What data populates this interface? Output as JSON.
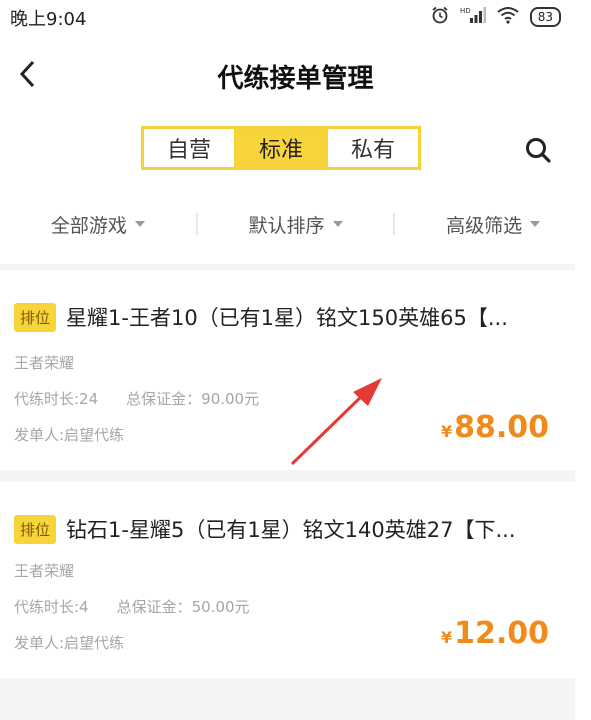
{
  "status_bar": {
    "time": "晚上9:04",
    "network": "HD",
    "battery": "83"
  },
  "header": {
    "title": "代练接单管理"
  },
  "segments": [
    {
      "label": "自营",
      "active": false
    },
    {
      "label": "标准",
      "active": true
    },
    {
      "label": "私有",
      "active": false
    }
  ],
  "filters": [
    {
      "label": "全部游戏"
    },
    {
      "label": "默认排序"
    },
    {
      "label": "高级筛选"
    }
  ],
  "orders": [
    {
      "tag": "排位",
      "title": "星耀1-王者10（已有1星）铭文150英雄65【...",
      "game": "王者荣耀",
      "duration": "代练时长:24",
      "deposit": "总保证金：90.00元",
      "publisher": "发单人:启望代练",
      "price_symbol": "¥",
      "price": "88.00"
    },
    {
      "tag": "排位",
      "title": "钻石1-星耀5（已有1星）铭文140英雄27【下...",
      "game": "王者荣耀",
      "duration": "代练时长:4",
      "deposit": "总保证金：50.00元",
      "publisher": "发单人:启望代练",
      "price_symbol": "¥",
      "price": "12.00"
    }
  ],
  "colors": {
    "accent": "#f8d43b",
    "price": "#f08a1a",
    "annotation_arrow": "#e53935"
  },
  "icons": [
    "back-arrow-icon",
    "search-icon",
    "alarm-icon",
    "signal-icon",
    "wifi-icon",
    "battery-icon",
    "caret-down-icon"
  ]
}
